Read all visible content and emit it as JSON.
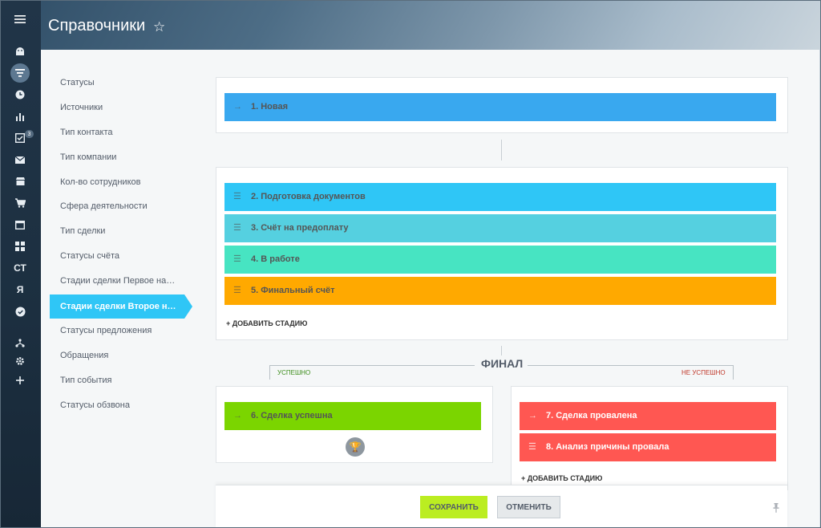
{
  "header": {
    "title": "Справочники"
  },
  "rail": {
    "icons": [
      "menu-icon",
      "android-icon",
      "filter-icon",
      "clock-icon",
      "chart-icon",
      "tasks-icon",
      "mail-icon",
      "shop-icon",
      "cart-icon",
      "window-icon",
      "apps-icon",
      "ct-icon",
      "ya-icon",
      "check-circle-icon",
      "sitemap-icon",
      "gear-icon",
      "plus-icon"
    ],
    "ct": "СТ",
    "ya": "Я",
    "tasks_badge": "3"
  },
  "sidebar": {
    "items": [
      "Статусы",
      "Источники",
      "Тип контакта",
      "Тип компании",
      "Кол-во сотрудников",
      "Сфера деятельности",
      "Тип сделки",
      "Статусы счёта",
      "Стадии сделки Первое на…",
      "Стадии сделки Второе н…",
      "Статусы предложения",
      "Обращения",
      "Тип события",
      "Статусы обзвона"
    ],
    "active_index": 9
  },
  "stages": {
    "first": {
      "label": "1. Новая",
      "color": "#39a8ef"
    },
    "middle": [
      {
        "label": "2. Подготовка документов",
        "color": "#2fc6f6"
      },
      {
        "label": "3. Счёт на предоплату",
        "color": "#55d0e0"
      },
      {
        "label": "4. В работе",
        "color": "#47e4c2"
      },
      {
        "label": "5. Финальный счёт",
        "color": "#ffa900"
      }
    ],
    "add_label": "+ ДОБАВИТЬ СТАДИЮ"
  },
  "final": {
    "title": "ФИНАЛ",
    "success_label": "УСПЕШНО",
    "fail_label": "НЕ УСПЕШНО",
    "success_stage": {
      "label": "6. Сделка успешна",
      "color": "#7bd500"
    },
    "fail_stages": [
      {
        "label": "7. Сделка провалена",
        "color": "#ff5752"
      },
      {
        "label": "8. Анализ причины провала",
        "color": "#ff5752"
      }
    ],
    "add_label": "+ ДОБАВИТЬ СТАДИЮ"
  },
  "footer": {
    "save": "СОХРАНИТЬ",
    "cancel": "ОТМЕНИТЬ"
  }
}
